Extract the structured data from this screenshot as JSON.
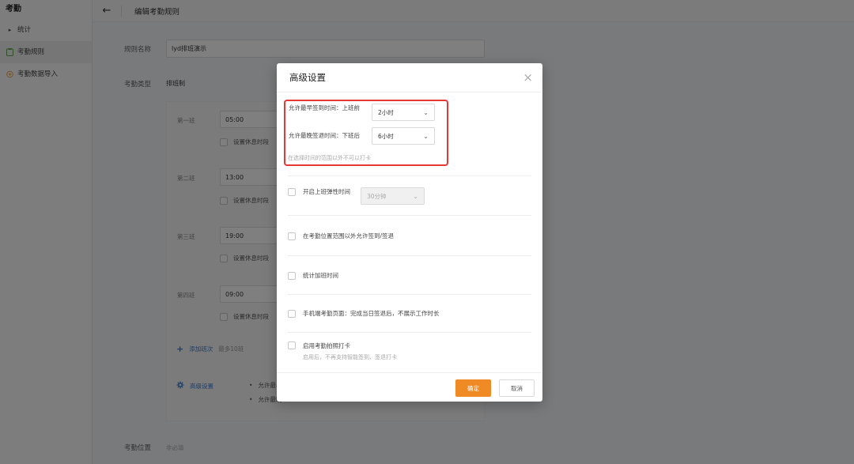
{
  "sidebar": {
    "app_title": "考勤",
    "items": [
      {
        "label": "统计"
      },
      {
        "label": "考勤规则"
      },
      {
        "label": "考勤数据导入"
      }
    ]
  },
  "topbar": {
    "back": "←",
    "title": "编辑考勤规则"
  },
  "form": {
    "rule_name_label": "规则名称",
    "rule_name_value": "lyd排班演示",
    "type_label": "考勤类型",
    "type_value": "排班制",
    "shifts": [
      {
        "label": "第一班",
        "time": "05:00",
        "break": "设置休息时段"
      },
      {
        "label": "第二班",
        "time": "13:00",
        "break": "设置休息时段"
      },
      {
        "label": "第三班",
        "time": "19:00",
        "break": "设置休息时段"
      },
      {
        "label": "第四班",
        "time": "09:00",
        "break": "设置休息时段"
      }
    ],
    "add_shift": "添加班次",
    "add_shift_hint": "最多10班",
    "advanced": "高级设置",
    "adv_item_1": "允许最早",
    "adv_item_2": "允许最晚",
    "location_label": "考勤位置",
    "location_hint": "非必填"
  },
  "modal": {
    "title": "高级设置",
    "close": "×",
    "earliest_label": "允许最早签到时间：上班前",
    "earliest_value": "2小时",
    "latest_label": "允许最晚签退时间：下班后",
    "latest_value": "6小时",
    "range_hint": "在选择时间的范围以外不可以打卡",
    "flex_label": "开启上班弹性时间",
    "flex_value": "30分钟",
    "outside_label": "在考勤位置范围以外允许签到/签退",
    "overtime_label": "统计加班时间",
    "mobile_label": "手机端考勤页面：完成当日签退后，不展示工作时长",
    "photo_label": "启用考勤拍照打卡",
    "photo_hint": "启用后，不再支持智能签到、签退打卡",
    "ok": "确定",
    "cancel": "取消"
  }
}
